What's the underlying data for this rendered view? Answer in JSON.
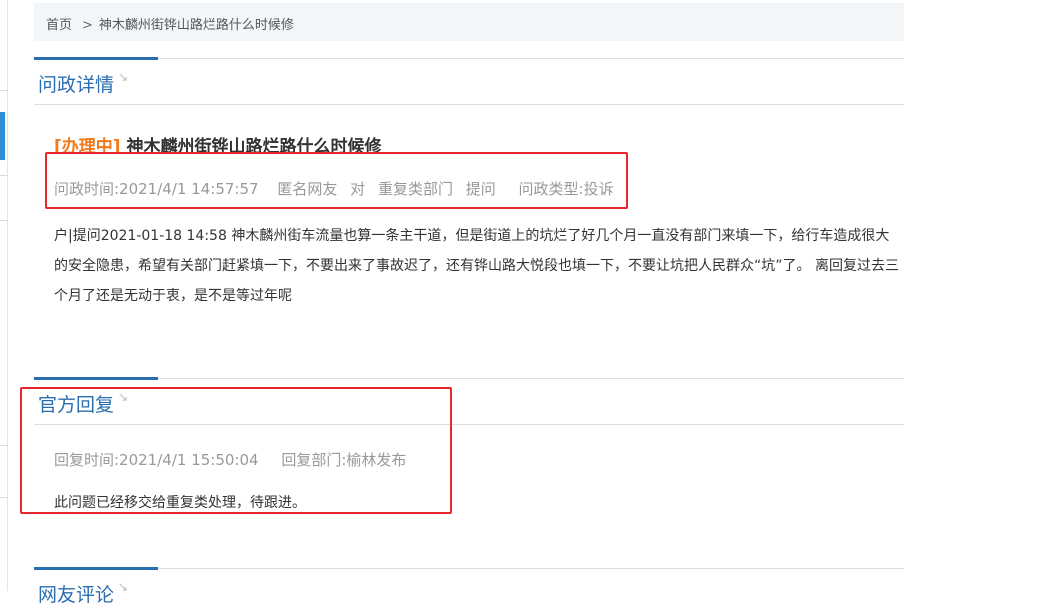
{
  "breadcrumb": {
    "home": "首页",
    "separator": ">",
    "current": "神木麟州街铧山路烂路什么时候修"
  },
  "detail_section": {
    "title": "问政详情"
  },
  "question": {
    "status": "[办理中]",
    "title": "神木麟州街铧山路烂路什么时候修",
    "meta": {
      "time": "问政时间:2021/4/1 14:57:57",
      "user": "匿名网友",
      "to": "对",
      "department": "重复类部门",
      "action": "提问",
      "type": "问政类型:投诉"
    },
    "content": "户|提问2021-01-18 14:58 神木麟州街车流量也算一条主干道，但是街道上的坑烂了好几个月一直没有部门来填一下，给行车造成很大的安全隐患，希望有关部门赶紧填一下，不要出来了事故迟了，还有铧山路大悦段也填一下，不要让坑把人民群众“坑”了。 离回复过去三个月了还是无动于衷，是不是等过年呢"
  },
  "reply_section": {
    "title": "官方回复"
  },
  "reply": {
    "time": "回复时间:2021/4/1 15:50:04",
    "department": "回复部门:榆林发布",
    "content": "此问题已经移交给重复类处理，待跟进。"
  },
  "comments_section": {
    "title": "网友评论"
  },
  "colors": {
    "accent_blue": "#2a6db0",
    "status_orange": "#f07a1c",
    "highlight_red": "#e8262c"
  }
}
